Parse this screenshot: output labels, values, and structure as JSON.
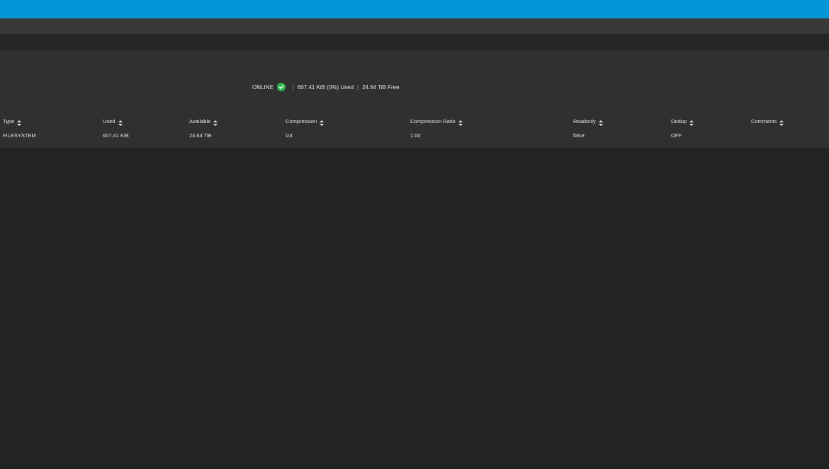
{
  "pool": {
    "status": "ONLINE",
    "used": "607.41 KiB (0%) Used",
    "free": "24.64 TiB Free",
    "separator": "|"
  },
  "table": {
    "columns": [
      "Type",
      "Used",
      "Available",
      "Compression",
      "Compression Ratio",
      "Readonly",
      "Dedup",
      "Comments"
    ],
    "rows": [
      [
        "FILESYSTEM",
        "607.41 KiB",
        "24.64 TiB",
        "lz4",
        "1.00",
        "false",
        "OFF",
        ""
      ]
    ]
  },
  "icons": {
    "status_ok": "check-circle-icon",
    "sort": "sort-icon"
  },
  "colors": {
    "topbar": "#0095d5",
    "status_ok": "#2db84d"
  }
}
